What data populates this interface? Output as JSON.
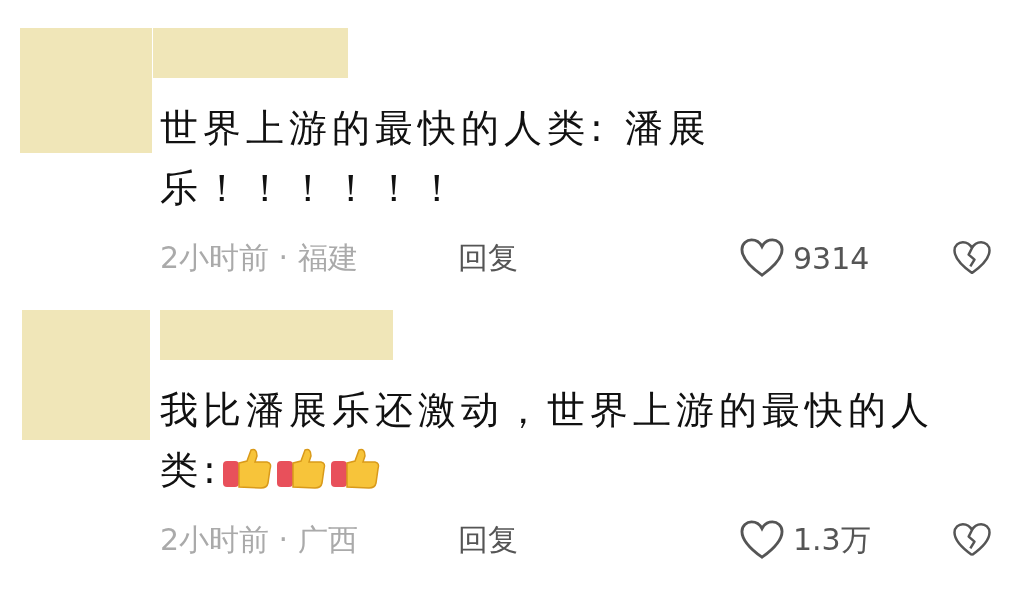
{
  "comments": [
    {
      "text_lines": [
        "世界上游的最快的人类: 潘展",
        "乐！！！！！！"
      ],
      "meta": "2小时前 · 福建",
      "reply": "回复",
      "likes": "9314"
    },
    {
      "text_lines": [
        "我比潘展乐还激动，世界上游的最快的人",
        "类:"
      ],
      "reactions": [
        {
          "kind": "thumbs_up"
        },
        {
          "kind": "thumbs_up"
        },
        {
          "kind": "thumbs_up"
        }
      ],
      "meta": "2小时前 · 广西",
      "reply": "回复",
      "likes": "1.3万"
    }
  ]
}
